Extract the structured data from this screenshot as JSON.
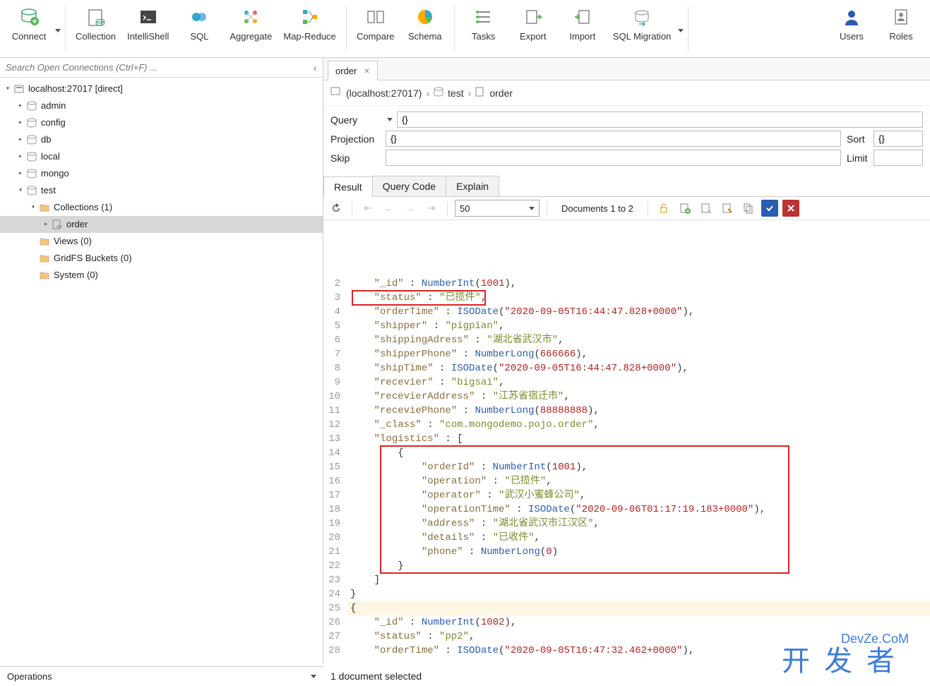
{
  "toolbar": {
    "connect": "Connect",
    "collection": "Collection",
    "intellishell": "IntelliShell",
    "sql": "SQL",
    "aggregate": "Aggregate",
    "mapreduce": "Map-Reduce",
    "compare": "Compare",
    "schema": "Schema",
    "tasks": "Tasks",
    "export": "Export",
    "import": "Import",
    "sqlmigration": "SQL Migration",
    "users": "Users",
    "roles": "Roles"
  },
  "search": {
    "placeholder": "Search Open Connections (Ctrl+F) ..."
  },
  "tree": {
    "host": "localhost:27017 [direct]",
    "dbs": {
      "admin": "admin",
      "config": "config",
      "db": "db",
      "local": "local",
      "mongo": "mongo",
      "test": "test"
    },
    "collections_folder": "Collections (1)",
    "order_collection": "order",
    "views": "Views (0)",
    "gridfs": "GridFS Buckets (0)",
    "system": "System (0)"
  },
  "tab": {
    "label": "order"
  },
  "breadcrumb": {
    "host": "(localhost:27017)",
    "db": "test",
    "coll": "order"
  },
  "form": {
    "query_label": "Query",
    "query_value": "{}",
    "projection_label": "Projection",
    "projection_value": "{}",
    "sort_label": "Sort",
    "sort_value": "{}",
    "skip_label": "Skip",
    "skip_value": "",
    "limit_label": "Limit",
    "limit_value": ""
  },
  "result_tabs": {
    "result": "Result",
    "query_code": "Query Code",
    "explain": "Explain"
  },
  "result_bar": {
    "page_size": "50",
    "doc_range": "Documents 1 to 2"
  },
  "editor": {
    "lines": [
      {
        "n": 2,
        "ind": 1,
        "tokens": [
          {
            "t": "k",
            "v": "\"_id\""
          },
          {
            "t": "p",
            "v": " : "
          },
          {
            "t": "f",
            "v": "NumberInt"
          },
          {
            "t": "p",
            "v": "("
          },
          {
            "t": "n",
            "v": "1001"
          },
          {
            "t": "p",
            "v": "),"
          }
        ]
      },
      {
        "n": 3,
        "ind": 1,
        "box": "a",
        "tokens": [
          {
            "t": "k",
            "v": "\"status\""
          },
          {
            "t": "p",
            "v": " : "
          },
          {
            "t": "s",
            "v": "\"已揽件\""
          },
          {
            "t": "p",
            "v": ","
          }
        ]
      },
      {
        "n": 4,
        "ind": 1,
        "tokens": [
          {
            "t": "k",
            "v": "\"orderTime\""
          },
          {
            "t": "p",
            "v": " : "
          },
          {
            "t": "f",
            "v": "ISODate"
          },
          {
            "t": "p",
            "v": "("
          },
          {
            "t": "n",
            "v": "\"2020-09-05T16:44:47.828+0000\""
          },
          {
            "t": "p",
            "v": "),"
          }
        ]
      },
      {
        "n": 5,
        "ind": 1,
        "tokens": [
          {
            "t": "k",
            "v": "\"shipper\""
          },
          {
            "t": "p",
            "v": " : "
          },
          {
            "t": "s",
            "v": "\"pigpian\""
          },
          {
            "t": "p",
            "v": ","
          }
        ]
      },
      {
        "n": 6,
        "ind": 1,
        "tokens": [
          {
            "t": "k",
            "v": "\"shippingAdress\""
          },
          {
            "t": "p",
            "v": " : "
          },
          {
            "t": "s",
            "v": "\"湖北省武汉市\""
          },
          {
            "t": "p",
            "v": ","
          }
        ]
      },
      {
        "n": 7,
        "ind": 1,
        "tokens": [
          {
            "t": "k",
            "v": "\"shipperPhone\""
          },
          {
            "t": "p",
            "v": " : "
          },
          {
            "t": "f",
            "v": "NumberLong"
          },
          {
            "t": "p",
            "v": "("
          },
          {
            "t": "n",
            "v": "666666"
          },
          {
            "t": "p",
            "v": "),"
          }
        ]
      },
      {
        "n": 8,
        "ind": 1,
        "tokens": [
          {
            "t": "k",
            "v": "\"shipTime\""
          },
          {
            "t": "p",
            "v": " : "
          },
          {
            "t": "f",
            "v": "ISODate"
          },
          {
            "t": "p",
            "v": "("
          },
          {
            "t": "n",
            "v": "\"2020-09-05T16:44:47.828+0000\""
          },
          {
            "t": "p",
            "v": "),"
          }
        ]
      },
      {
        "n": 9,
        "ind": 1,
        "tokens": [
          {
            "t": "k",
            "v": "\"recevier\""
          },
          {
            "t": "p",
            "v": " : "
          },
          {
            "t": "s",
            "v": "\"bigsai\""
          },
          {
            "t": "p",
            "v": ","
          }
        ]
      },
      {
        "n": 10,
        "ind": 1,
        "tokens": [
          {
            "t": "k",
            "v": "\"recevierAddress\""
          },
          {
            "t": "p",
            "v": " : "
          },
          {
            "t": "s",
            "v": "\"江苏省宿迁市\""
          },
          {
            "t": "p",
            "v": ","
          }
        ]
      },
      {
        "n": 11,
        "ind": 1,
        "tokens": [
          {
            "t": "k",
            "v": "\"receviePhone\""
          },
          {
            "t": "p",
            "v": " : "
          },
          {
            "t": "f",
            "v": "NumberLong"
          },
          {
            "t": "p",
            "v": "("
          },
          {
            "t": "n",
            "v": "88888888"
          },
          {
            "t": "p",
            "v": "),"
          }
        ]
      },
      {
        "n": 12,
        "ind": 1,
        "tokens": [
          {
            "t": "k",
            "v": "\"_class\""
          },
          {
            "t": "p",
            "v": " : "
          },
          {
            "t": "s",
            "v": "\"com.mongodemo.pojo.order\""
          },
          {
            "t": "p",
            "v": ","
          }
        ]
      },
      {
        "n": 13,
        "ind": 1,
        "tokens": [
          {
            "t": "k",
            "v": "\"logistics\""
          },
          {
            "t": "p",
            "v": " : ["
          }
        ]
      },
      {
        "n": 14,
        "ind": 2,
        "tokens": [
          {
            "t": "p",
            "v": "{"
          }
        ]
      },
      {
        "n": 15,
        "ind": 3,
        "tokens": [
          {
            "t": "k",
            "v": "\"orderId\""
          },
          {
            "t": "p",
            "v": " : "
          },
          {
            "t": "f",
            "v": "NumberInt"
          },
          {
            "t": "p",
            "v": "("
          },
          {
            "t": "n",
            "v": "1001"
          },
          {
            "t": "p",
            "v": "),"
          }
        ]
      },
      {
        "n": 16,
        "ind": 3,
        "tokens": [
          {
            "t": "k",
            "v": "\"operation\""
          },
          {
            "t": "p",
            "v": " : "
          },
          {
            "t": "s",
            "v": "\"已揽件\""
          },
          {
            "t": "p",
            "v": ","
          }
        ]
      },
      {
        "n": 17,
        "ind": 3,
        "tokens": [
          {
            "t": "k",
            "v": "\"operator\""
          },
          {
            "t": "p",
            "v": " : "
          },
          {
            "t": "s",
            "v": "\"武汉小蜜蜂公司\""
          },
          {
            "t": "p",
            "v": ","
          }
        ]
      },
      {
        "n": 18,
        "ind": 3,
        "tokens": [
          {
            "t": "k",
            "v": "\"operationTime\""
          },
          {
            "t": "p",
            "v": " : "
          },
          {
            "t": "f",
            "v": "ISODate"
          },
          {
            "t": "p",
            "v": "("
          },
          {
            "t": "n",
            "v": "\"2020-09-06T01:17:19.183+0000\""
          },
          {
            "t": "p",
            "v": "),"
          }
        ]
      },
      {
        "n": 19,
        "ind": 3,
        "tokens": [
          {
            "t": "k",
            "v": "\"address\""
          },
          {
            "t": "p",
            "v": " : "
          },
          {
            "t": "s",
            "v": "\"湖北省武汉市江汉区\""
          },
          {
            "t": "p",
            "v": ","
          }
        ]
      },
      {
        "n": 20,
        "ind": 3,
        "tokens": [
          {
            "t": "k",
            "v": "\"details\""
          },
          {
            "t": "p",
            "v": " : "
          },
          {
            "t": "s",
            "v": "\"已收件\""
          },
          {
            "t": "p",
            "v": ","
          }
        ]
      },
      {
        "n": 21,
        "ind": 3,
        "tokens": [
          {
            "t": "k",
            "v": "\"phone\""
          },
          {
            "t": "p",
            "v": " : "
          },
          {
            "t": "f",
            "v": "NumberLong"
          },
          {
            "t": "p",
            "v": "("
          },
          {
            "t": "n",
            "v": "0"
          },
          {
            "t": "p",
            "v": ")"
          }
        ]
      },
      {
        "n": 22,
        "ind": 2,
        "tokens": [
          {
            "t": "p",
            "v": "}"
          }
        ]
      },
      {
        "n": 23,
        "ind": 1,
        "tokens": [
          {
            "t": "p",
            "v": "]"
          }
        ]
      },
      {
        "n": 24,
        "ind": 0,
        "tokens": [
          {
            "t": "p",
            "v": "}"
          }
        ]
      },
      {
        "n": 25,
        "ind": 0,
        "current": true,
        "tokens": [
          {
            "t": "p",
            "v": "{"
          }
        ]
      },
      {
        "n": 26,
        "ind": 1,
        "tokens": [
          {
            "t": "k",
            "v": "\"_id\""
          },
          {
            "t": "p",
            "v": " : "
          },
          {
            "t": "f",
            "v": "NumberInt"
          },
          {
            "t": "p",
            "v": "("
          },
          {
            "t": "n",
            "v": "1002"
          },
          {
            "t": "p",
            "v": "),"
          }
        ]
      },
      {
        "n": 27,
        "ind": 1,
        "tokens": [
          {
            "t": "k",
            "v": "\"status\""
          },
          {
            "t": "p",
            "v": " : "
          },
          {
            "t": "s",
            "v": "\"pp2\""
          },
          {
            "t": "p",
            "v": ","
          }
        ]
      },
      {
        "n": 28,
        "ind": 1,
        "tokens": [
          {
            "t": "k",
            "v": "\"orderTime\""
          },
          {
            "t": "p",
            "v": " : "
          },
          {
            "t": "f",
            "v": "ISODate"
          },
          {
            "t": "p",
            "v": "("
          },
          {
            "t": "n",
            "v": "\"2020-09-05T16:47:32.462+0000\""
          },
          {
            "t": "p",
            "v": "),"
          }
        ]
      }
    ]
  },
  "operations": {
    "label": "Operations"
  },
  "status": {
    "text": "1 document selected"
  },
  "watermark": {
    "line1": "开发者",
    "line2": "DevZe.CoM"
  }
}
